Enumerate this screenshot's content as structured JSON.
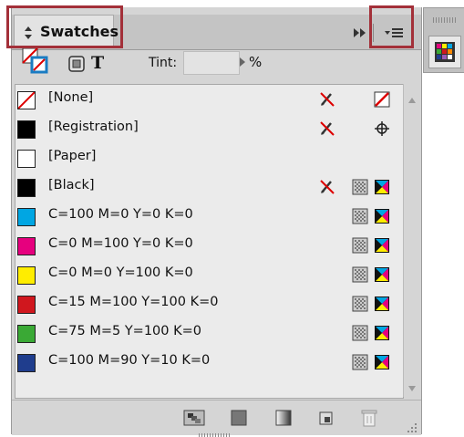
{
  "panel": {
    "tab_title": "Swatches",
    "toolbar": {
      "tint_label": "Tint:",
      "tint_value": "",
      "tint_unit": "%"
    },
    "swatches": [
      {
        "label": "[None]",
        "color": "#ffffff",
        "type": "none",
        "icons": [
          "no-edit-icon",
          "none-swatch-icon"
        ]
      },
      {
        "label": "[Registration]",
        "color": "#000000",
        "type": "registration",
        "icons": [
          "no-edit-icon",
          "registration-icon"
        ]
      },
      {
        "label": "[Paper]",
        "color": "#ffffff",
        "type": "paper",
        "icons": []
      },
      {
        "label": "[Black]",
        "color": "#000000",
        "type": "process",
        "icons": [
          "no-edit-icon",
          "process-icon",
          "cmyk-icon"
        ]
      },
      {
        "label": "C=100 M=0 Y=0 K=0",
        "color": "#00a6e3",
        "type": "process",
        "icons": [
          "process-icon",
          "cmyk-icon"
        ]
      },
      {
        "label": "C=0 M=100 Y=0 K=0",
        "color": "#e6007e",
        "type": "process",
        "icons": [
          "process-icon",
          "cmyk-icon"
        ]
      },
      {
        "label": "C=0 M=0 Y=100 K=0",
        "color": "#ffed00",
        "type": "process",
        "icons": [
          "process-icon",
          "cmyk-icon"
        ]
      },
      {
        "label": "C=15 M=100 Y=100 K=0",
        "color": "#d0171e",
        "type": "process",
        "icons": [
          "process-icon",
          "cmyk-icon"
        ]
      },
      {
        "label": "C=75 M=5 Y=100 K=0",
        "color": "#3aa935",
        "type": "process",
        "icons": [
          "process-icon",
          "cmyk-icon"
        ]
      },
      {
        "label": "C=100 M=90 Y=10 K=0",
        "color": "#1f3d8d",
        "type": "process",
        "icons": [
          "process-icon",
          "cmyk-icon"
        ]
      }
    ]
  },
  "colors": {
    "highlight": "#a33039"
  }
}
